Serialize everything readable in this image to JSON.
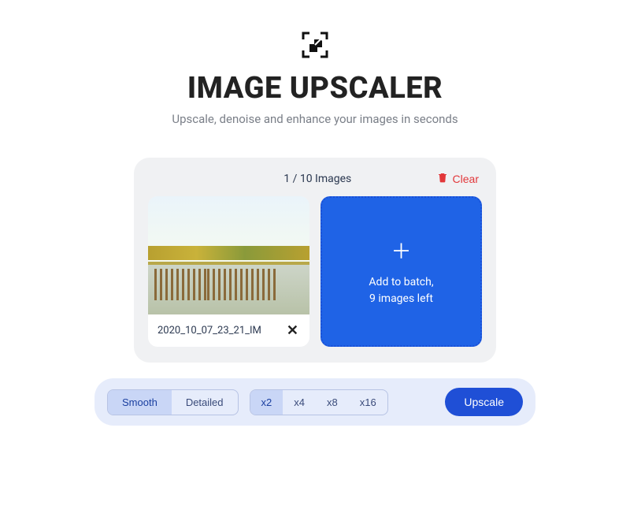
{
  "header": {
    "title": "IMAGE UPSCALER",
    "subtitle": "Upscale, denoise and enhance your images in seconds"
  },
  "panel": {
    "count_label": "1 / 10 Images",
    "clear_label": "Clear",
    "thumb": {
      "filename": "2020_10_07_23_21_IM"
    },
    "dropzone": {
      "line1": "Add to batch,",
      "line2": "9 images left"
    }
  },
  "controls": {
    "mode": {
      "options": [
        "Smooth",
        "Detailed"
      ],
      "active": 0
    },
    "scale": {
      "options": [
        "x2",
        "x4",
        "x8",
        "x16"
      ],
      "active": 0
    },
    "upscale_label": "Upscale"
  }
}
